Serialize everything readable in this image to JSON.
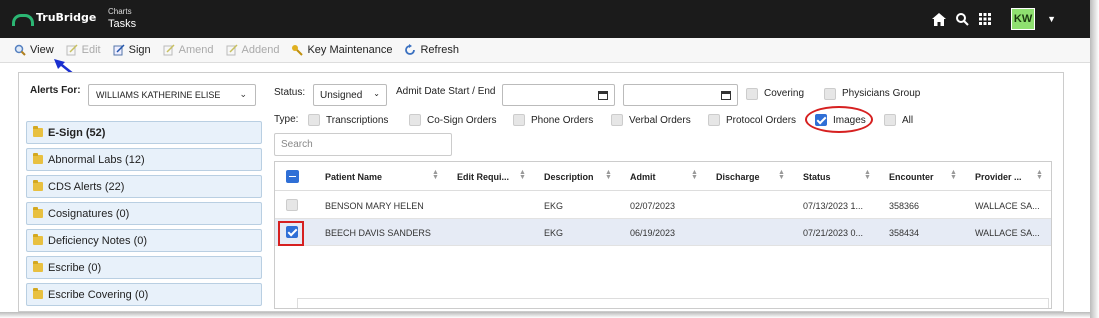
{
  "app": {
    "brand": "TruBridge",
    "crumb_small": "Charts",
    "crumb_title": "Tasks",
    "avatar_initials": "KW"
  },
  "toolbar": {
    "view": "View",
    "edit": "Edit",
    "sign": "Sign",
    "amend": "Amend",
    "addend": "Addend",
    "key_maintenance": "Key Maintenance",
    "refresh": "Refresh"
  },
  "alerts": {
    "label": "Alerts For:",
    "selected_user": "WILLIAMS KATHERINE ELISE",
    "items": [
      {
        "label": "E-Sign (52)",
        "bold": true
      },
      {
        "label": "Abnormal Labs (12)"
      },
      {
        "label": "CDS Alerts (22)"
      },
      {
        "label": "Cosignatures (0)"
      },
      {
        "label": "Deficiency Notes (0)"
      },
      {
        "label": "Escribe (0)"
      },
      {
        "label": "Escribe Covering (0)"
      }
    ]
  },
  "filters": {
    "status_label": "Status:",
    "status_value": "Unsigned",
    "admit_date_label": "Admit Date Start / End",
    "covering": "Covering",
    "physicians_group": "Physicians Group",
    "type_label": "Type:",
    "types": [
      {
        "label": "Transcriptions",
        "checked": false
      },
      {
        "label": "Co-Sign Orders",
        "checked": false
      },
      {
        "label": "Phone Orders",
        "checked": false
      },
      {
        "label": "Verbal Orders",
        "checked": false
      },
      {
        "label": "Protocol Orders",
        "checked": false
      },
      {
        "label": "Images",
        "checked": true
      },
      {
        "label": "All",
        "checked": false
      }
    ],
    "search_placeholder": "Search"
  },
  "grid": {
    "columns": [
      "Patient Name",
      "Edit Requi...",
      "Description",
      "Admit",
      "Discharge",
      "Status",
      "Encounter",
      "Provider ..."
    ],
    "rows": [
      {
        "patient": "BENSON MARY HELEN",
        "edit_req": "",
        "description": "EKG",
        "admit": "02/07/2023",
        "discharge": "",
        "status": "07/13/2023 1...",
        "encounter": "358366",
        "provider": "WALLACE SA...",
        "selected": false
      },
      {
        "patient": "BEECH DAVIS SANDERS",
        "edit_req": "",
        "description": "EKG",
        "admit": "06/19/2023",
        "discharge": "",
        "status": "07/21/2023 0...",
        "encounter": "358434",
        "provider": "WALLACE SA...",
        "selected": true
      }
    ]
  },
  "colors": {
    "topbar": "#1b1b1b",
    "accent_green": "#2bb673",
    "checkbox_blue": "#2f6fd6",
    "annotation_red": "#d62020",
    "arrow_blue": "#1a2fd0"
  }
}
